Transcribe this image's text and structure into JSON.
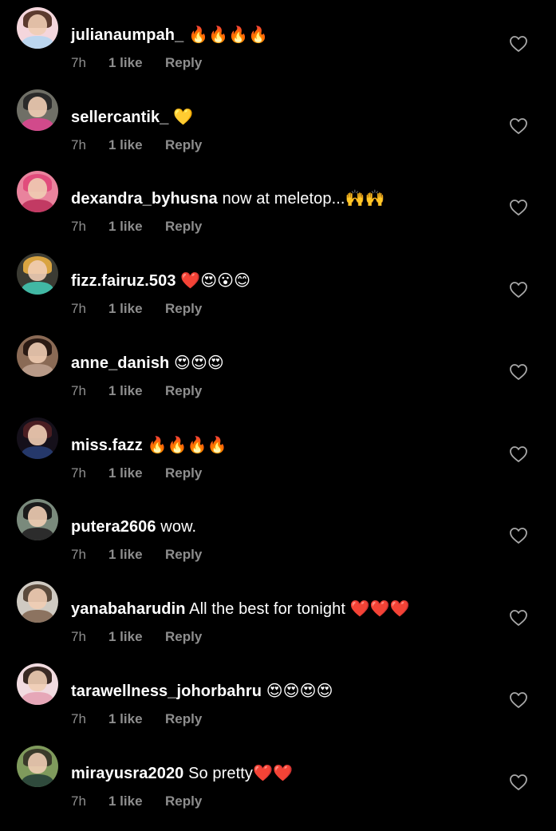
{
  "comments": [
    {
      "username": "julianaumpah_",
      "text": "🔥🔥🔥🔥",
      "time": "7h",
      "likes": "1 like",
      "reply": "Reply",
      "avatar_colors": [
        "#f4d6dc",
        "#5b3a2e",
        "#bcd6ef"
      ]
    },
    {
      "username": "sellercantik_",
      "text": "💛",
      "time": "7h",
      "likes": "1 like",
      "reply": "Reply",
      "avatar_colors": [
        "#6f6f66",
        "#2a2a2a",
        "#d14a8b"
      ]
    },
    {
      "username": "dexandra_byhusna",
      "text": "now at meletop...🙌🙌",
      "time": "7h",
      "likes": "1 like",
      "reply": "Reply",
      "avatar_colors": [
        "#e9839d",
        "#e14c7c",
        "#c23a63"
      ]
    },
    {
      "username": "fizz.fairuz.503",
      "text": "❤️😍😮😊",
      "time": "7h",
      "likes": "1 like",
      "reply": "Reply",
      "avatar_colors": [
        "#3b3b33",
        "#d9a441",
        "#41b8a4"
      ]
    },
    {
      "username": "anne_danish",
      "text": "😍😍😍",
      "time": "7h",
      "likes": "1 like",
      "reply": "Reply",
      "avatar_colors": [
        "#8a6a55",
        "#2a1a14",
        "#b89a88"
      ]
    },
    {
      "username": "miss.fazz",
      "text": "🔥🔥🔥🔥",
      "time": "7h",
      "likes": "1 like",
      "reply": "Reply",
      "avatar_colors": [
        "#15101a",
        "#4a1e22",
        "#25386a"
      ]
    },
    {
      "username": "putera2606",
      "text": "wow.",
      "time": "7h",
      "likes": "1 like",
      "reply": "Reply",
      "avatar_colors": [
        "#7a8a7c",
        "#1a1a1a",
        "#2c2c2c"
      ]
    },
    {
      "username": "yanabaharudin",
      "text": "All the best for tonight ❤️❤️❤️",
      "time": "7h",
      "likes": "1 like",
      "reply": "Reply",
      "avatar_colors": [
        "#cfcac2",
        "#5a4a3c",
        "#8c7360"
      ]
    },
    {
      "username": "tarawellness_johorbahru",
      "text": "😍😍😍😍",
      "time": "7h",
      "likes": "1 like",
      "reply": "Reply",
      "avatar_colors": [
        "#f1dbe0",
        "#3a2a24",
        "#e6a7b8"
      ]
    },
    {
      "username": "mirayusra2020",
      "text": "So pretty❤️❤️",
      "time": "7h",
      "likes": "1 like",
      "reply": "Reply",
      "avatar_colors": [
        "#7f9a5c",
        "#3a3a2a",
        "#2f4a3c"
      ]
    }
  ]
}
